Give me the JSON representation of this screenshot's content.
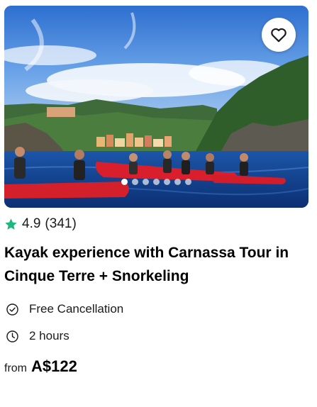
{
  "card": {
    "title": "Kayak experience with Carnassa Tour in Cinque Terre + Snorkeling",
    "rating": {
      "score": "4.9",
      "count_text": "(341)",
      "icon": "star-icon",
      "color": "#1db67d"
    },
    "features": [
      {
        "icon": "check-circle-icon",
        "label": "Free Cancellation"
      },
      {
        "icon": "clock-icon",
        "label": "2 hours"
      }
    ],
    "price": {
      "prefix": "from",
      "amount": "A$122"
    },
    "image": {
      "description_icon": "tour-photo",
      "carousel_count": 7,
      "active_index": 0
    },
    "favorite": {
      "icon": "heart-outline-icon"
    }
  }
}
